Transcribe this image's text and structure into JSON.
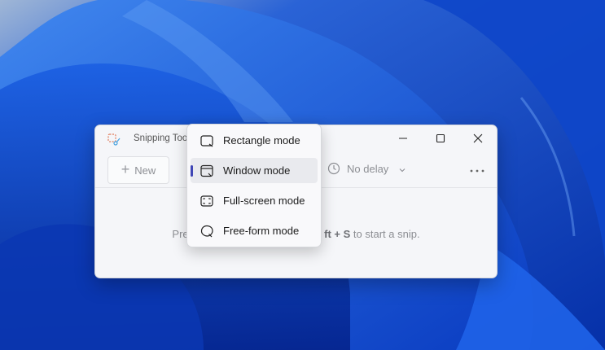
{
  "window": {
    "title": "Snipping Tool",
    "title_visible": "Snipping Too",
    "controls": {
      "minimize_icon": "minimize-icon",
      "maximize_icon": "maximize-icon",
      "close_icon": "close-icon"
    }
  },
  "toolbar": {
    "new_label": "New",
    "delay_label": "No delay",
    "more_icon": "more-icon"
  },
  "hint": {
    "prefix": "Pres",
    "key_part": "ft + S",
    "suffix": " to start a snip."
  },
  "mode_menu": {
    "items": [
      {
        "label": "Rectangle mode",
        "icon": "rectangle-snip-icon",
        "selected": false
      },
      {
        "label": "Window mode",
        "icon": "window-snip-icon",
        "selected": true
      },
      {
        "label": "Full-screen mode",
        "icon": "fullscreen-snip-icon",
        "selected": false
      },
      {
        "label": "Free-form mode",
        "icon": "freeform-snip-icon",
        "selected": false
      }
    ]
  },
  "colors": {
    "accent": "#3f46b5",
    "wallpaper": "#0a3fb8"
  }
}
